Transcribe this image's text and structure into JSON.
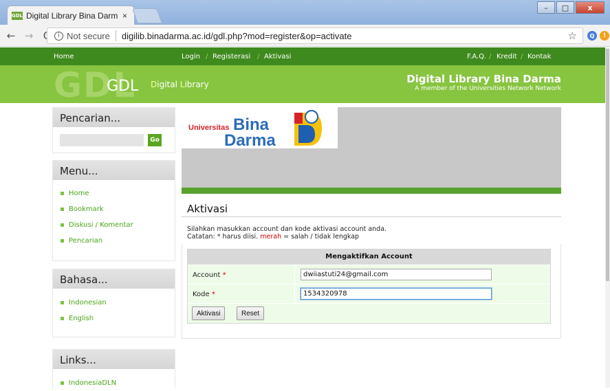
{
  "browser": {
    "tab_title": "Digital Library Bina Darm",
    "tab_close": "×",
    "favicon_text": "GDL",
    "not_secure": "Not secure",
    "url": "digilib.binadarma.ac.id/gdl.php?mod=register&op=activate",
    "back": "←",
    "forward": "→",
    "reload": "C",
    "star": "☆",
    "info": "i",
    "win_min": "–",
    "win_max": "□",
    "win_close": "x"
  },
  "topnav": {
    "home": "Home",
    "login": "Login",
    "register": "Registerasi",
    "activate": "Aktivasi",
    "faq": "F.A.Q.",
    "credit": "Kredit",
    "contact": "Kontak",
    "slash": "/"
  },
  "banner": {
    "gdl_big": "GDL",
    "gdl_small": "GDL",
    "dl_first_d": "D",
    "dl_rest1": "igital ",
    "dl_first_l": "L",
    "dl_rest2": "ibrary",
    "title": "Digital Library Bina Darma",
    "subtitle": "A member of the Universities Network Network"
  },
  "sidebar": {
    "search_title": "Pencarian...",
    "go_label": "Go",
    "menu_title": "Menu...",
    "menu_items": [
      "Home",
      "Bookmark",
      "Diskusi / Komentar",
      "Pencarian"
    ],
    "lang_title": "Bahasa...",
    "lang_items": [
      "Indonesian",
      "English"
    ],
    "links_title": "Links...",
    "links_items": [
      "IndonesiaDLN"
    ]
  },
  "logo": {
    "universitas": "Universitas",
    "bina": "Bina",
    "darma": "Darma"
  },
  "main": {
    "heading": "Aktivasi",
    "intro_line1": "Silahkan masukkan account dan kode aktivasi account anda.",
    "intro_prefix": "Catatan: * harus diisi. ",
    "intro_red": "merah",
    "intro_suffix": " = salah / tidak lengkap",
    "form_title": "Mengaktifkan Account",
    "account_label": "Account",
    "code_label": "Kode",
    "required_mark": "*",
    "account_value": "dwiiastuti24@gmail.com",
    "code_value": "1534320978",
    "activate_button": "Aktivasi",
    "reset_button": "Reset"
  },
  "colors": {
    "nav_green": "#3f8a1e",
    "banner_green": "#87c440",
    "link_green": "#4aa518",
    "required_red": "#d10000"
  }
}
